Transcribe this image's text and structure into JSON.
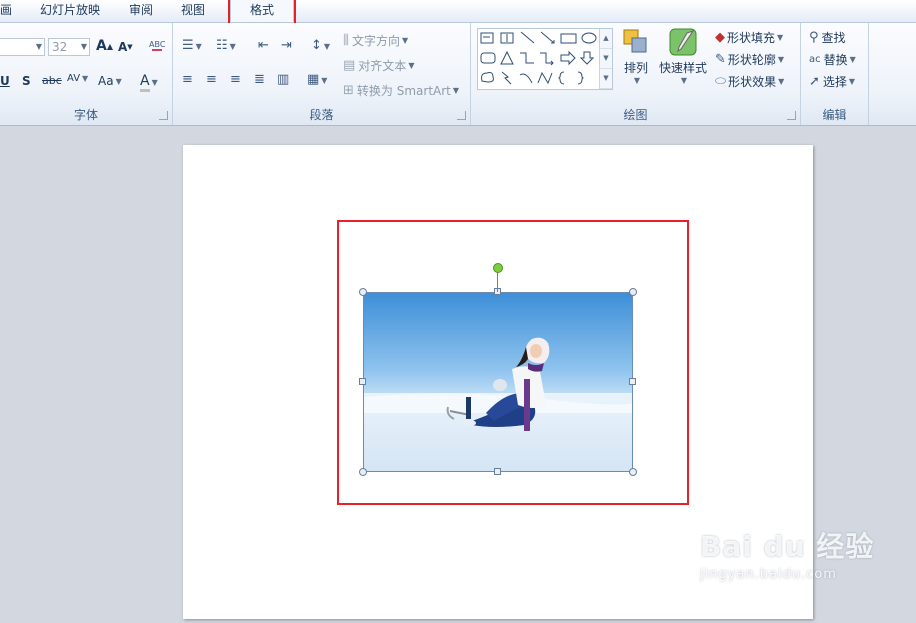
{
  "tabs": {
    "partial": "画",
    "slideshow": "幻灯片放映",
    "review": "审阅",
    "view": "视图",
    "format": "格式"
  },
  "font_group": {
    "font_size": "32",
    "grow_font": "A",
    "shrink_font": "A",
    "underline": "U",
    "shadow": "S",
    "strike": "abc",
    "spacing": "AV",
    "change_case": "Aa",
    "font_color": "A",
    "label": "字体"
  },
  "paragraph_group": {
    "text_direction": "文字方向",
    "align_text": "对齐文本",
    "convert_smartart": "转换为 SmartArt",
    "label": "段落"
  },
  "drawing_group": {
    "arrange": "排列",
    "quick_styles": "快速样式",
    "shape_fill": "形状填充",
    "shape_outline": "形状轮廓",
    "shape_effects": "形状效果",
    "label": "绘图"
  },
  "editing_group": {
    "find": "查找",
    "replace": "替换",
    "select": "选择",
    "label": "编辑"
  },
  "watermark": {
    "brand": "Bai du 经验",
    "url": "jingyan.baidu.com"
  },
  "colors": {
    "highlight": "#e8202a",
    "ribbon_text": "#1e395b",
    "workspace": "#d3d8e0"
  }
}
